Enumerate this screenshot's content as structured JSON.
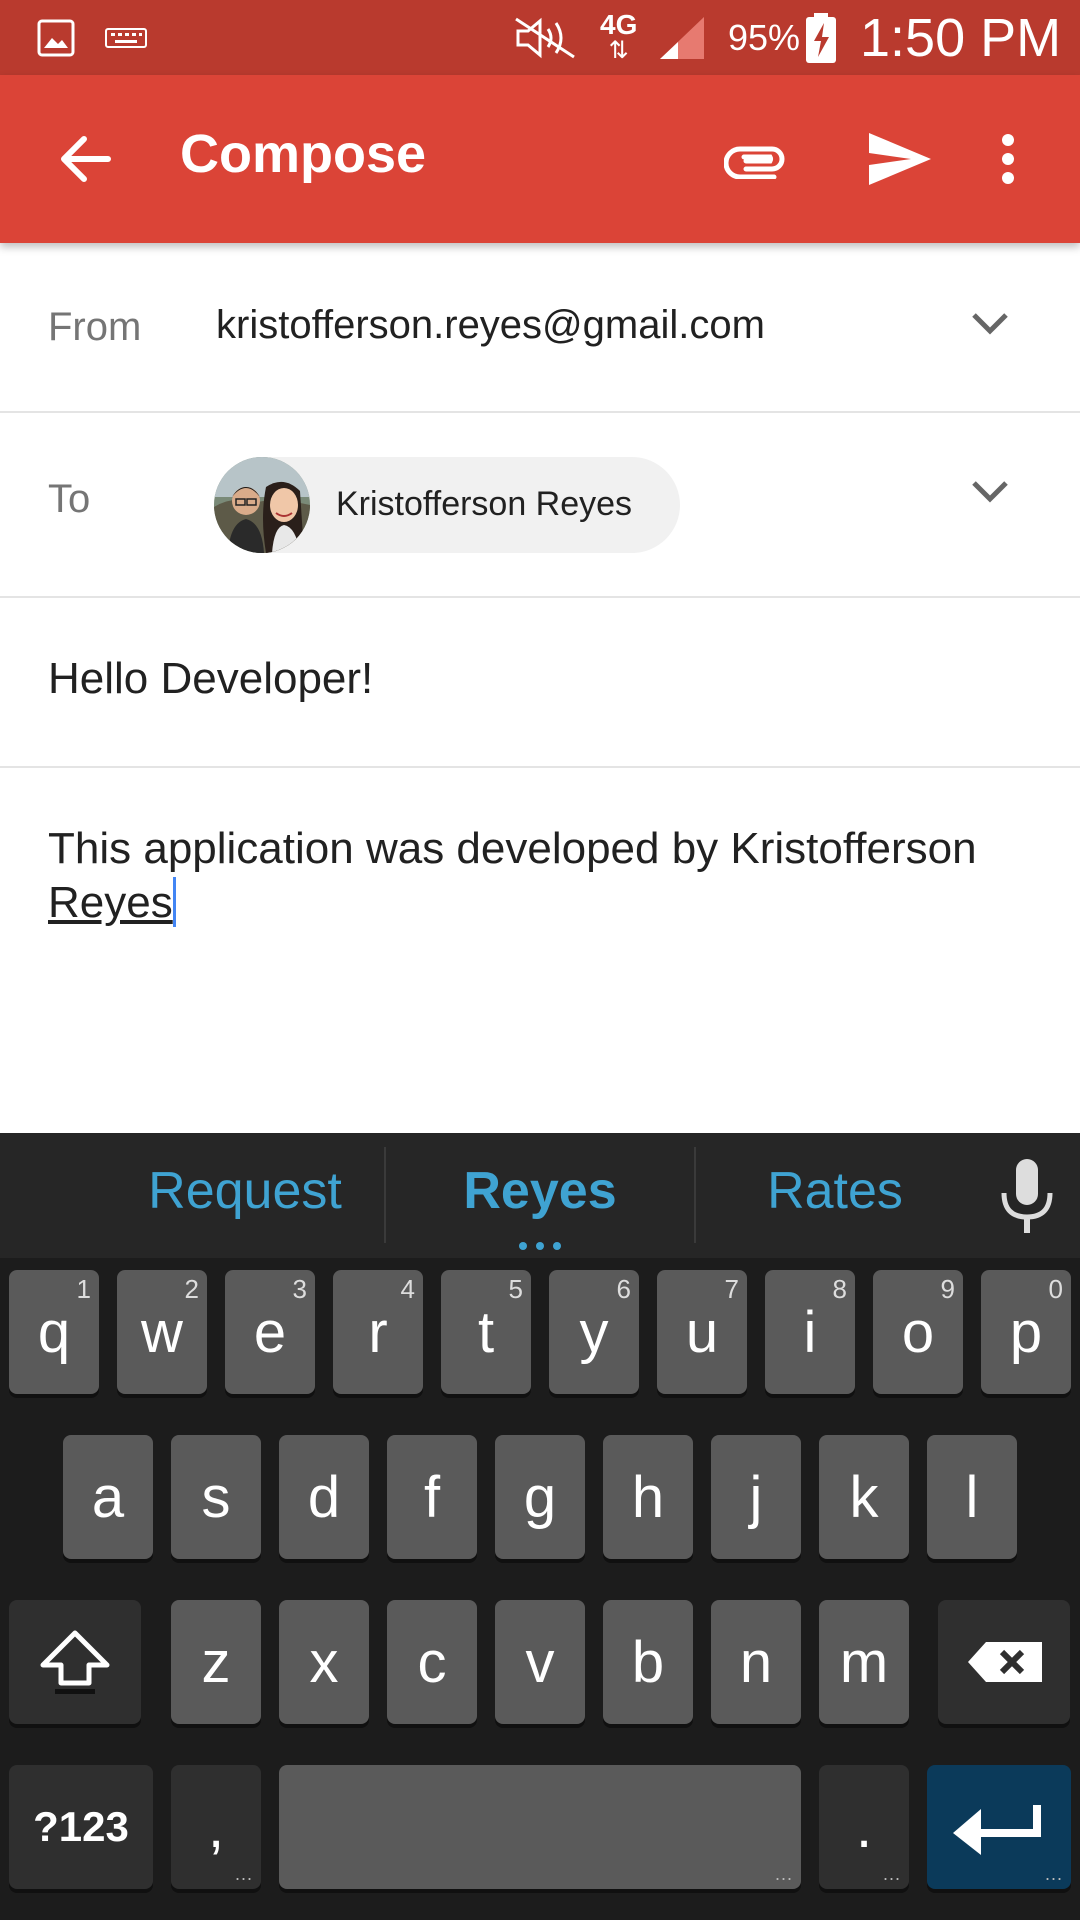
{
  "status_bar": {
    "network": "4G",
    "battery": "95%",
    "time": "1:50 PM",
    "icons": [
      "gallery-icon",
      "keyboard-icon",
      "mute-icon",
      "network-icon",
      "signal-icon",
      "battery-charging-icon"
    ]
  },
  "app_bar": {
    "title": "Compose",
    "color": "#db4437",
    "icons": [
      "back-arrow-icon",
      "attachment-icon",
      "send-icon",
      "more-vert-icon"
    ]
  },
  "from": {
    "label": "From",
    "value": "kristofferson.reyes@gmail.com"
  },
  "to": {
    "label": "To",
    "recipient": "Kristofferson Reyes"
  },
  "subject": {
    "value": "Hello Developer!"
  },
  "body": {
    "text_prefix": "This application was developed by Kristofferson ",
    "text_composing": "Reyes"
  },
  "keyboard": {
    "suggestions": [
      "Request",
      "Reyes",
      "Rates"
    ],
    "row1": [
      {
        "key": "q",
        "hint": "1"
      },
      {
        "key": "w",
        "hint": "2"
      },
      {
        "key": "e",
        "hint": "3"
      },
      {
        "key": "r",
        "hint": "4"
      },
      {
        "key": "t",
        "hint": "5"
      },
      {
        "key": "y",
        "hint": "6"
      },
      {
        "key": "u",
        "hint": "7"
      },
      {
        "key": "i",
        "hint": "8"
      },
      {
        "key": "o",
        "hint": "9"
      },
      {
        "key": "p",
        "hint": "0"
      }
    ],
    "row2": [
      "a",
      "s",
      "d",
      "f",
      "g",
      "h",
      "j",
      "k",
      "l"
    ],
    "row3": [
      "z",
      "x",
      "c",
      "v",
      "b",
      "n",
      "m"
    ],
    "symbols_key": "?123",
    "comma_key": ",",
    "period_key": ".",
    "accent_color": "#3fa3d2",
    "enter_color": "#0b3a5a"
  }
}
